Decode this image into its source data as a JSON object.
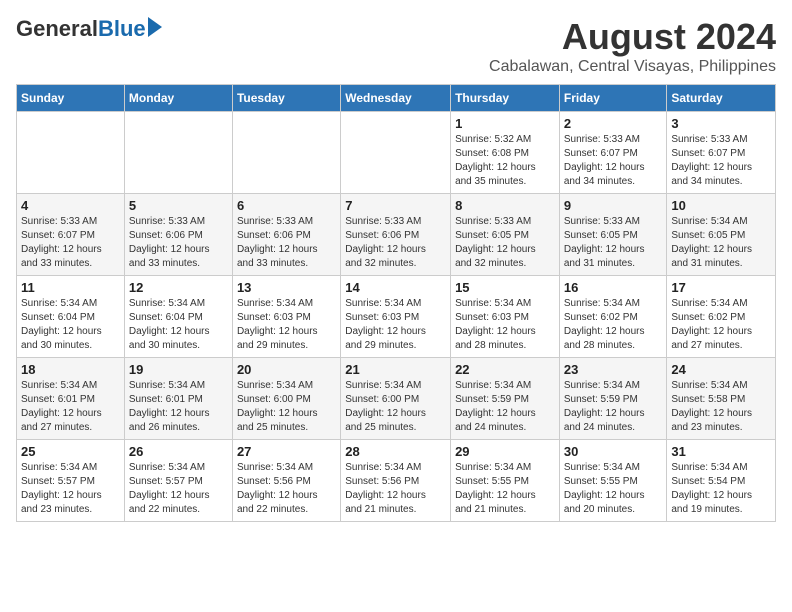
{
  "logo": {
    "general": "General",
    "blue": "Blue"
  },
  "title": "August 2024",
  "subtitle": "Cabalawan, Central Visayas, Philippines",
  "days_of_week": [
    "Sunday",
    "Monday",
    "Tuesday",
    "Wednesday",
    "Thursday",
    "Friday",
    "Saturday"
  ],
  "weeks": [
    [
      {
        "day": "",
        "info": ""
      },
      {
        "day": "",
        "info": ""
      },
      {
        "day": "",
        "info": ""
      },
      {
        "day": "",
        "info": ""
      },
      {
        "day": "1",
        "info": "Sunrise: 5:32 AM\nSunset: 6:08 PM\nDaylight: 12 hours\nand 35 minutes."
      },
      {
        "day": "2",
        "info": "Sunrise: 5:33 AM\nSunset: 6:07 PM\nDaylight: 12 hours\nand 34 minutes."
      },
      {
        "day": "3",
        "info": "Sunrise: 5:33 AM\nSunset: 6:07 PM\nDaylight: 12 hours\nand 34 minutes."
      }
    ],
    [
      {
        "day": "4",
        "info": "Sunrise: 5:33 AM\nSunset: 6:07 PM\nDaylight: 12 hours\nand 33 minutes."
      },
      {
        "day": "5",
        "info": "Sunrise: 5:33 AM\nSunset: 6:06 PM\nDaylight: 12 hours\nand 33 minutes."
      },
      {
        "day": "6",
        "info": "Sunrise: 5:33 AM\nSunset: 6:06 PM\nDaylight: 12 hours\nand 33 minutes."
      },
      {
        "day": "7",
        "info": "Sunrise: 5:33 AM\nSunset: 6:06 PM\nDaylight: 12 hours\nand 32 minutes."
      },
      {
        "day": "8",
        "info": "Sunrise: 5:33 AM\nSunset: 6:05 PM\nDaylight: 12 hours\nand 32 minutes."
      },
      {
        "day": "9",
        "info": "Sunrise: 5:33 AM\nSunset: 6:05 PM\nDaylight: 12 hours\nand 31 minutes."
      },
      {
        "day": "10",
        "info": "Sunrise: 5:34 AM\nSunset: 6:05 PM\nDaylight: 12 hours\nand 31 minutes."
      }
    ],
    [
      {
        "day": "11",
        "info": "Sunrise: 5:34 AM\nSunset: 6:04 PM\nDaylight: 12 hours\nand 30 minutes."
      },
      {
        "day": "12",
        "info": "Sunrise: 5:34 AM\nSunset: 6:04 PM\nDaylight: 12 hours\nand 30 minutes."
      },
      {
        "day": "13",
        "info": "Sunrise: 5:34 AM\nSunset: 6:03 PM\nDaylight: 12 hours\nand 29 minutes."
      },
      {
        "day": "14",
        "info": "Sunrise: 5:34 AM\nSunset: 6:03 PM\nDaylight: 12 hours\nand 29 minutes."
      },
      {
        "day": "15",
        "info": "Sunrise: 5:34 AM\nSunset: 6:03 PM\nDaylight: 12 hours\nand 28 minutes."
      },
      {
        "day": "16",
        "info": "Sunrise: 5:34 AM\nSunset: 6:02 PM\nDaylight: 12 hours\nand 28 minutes."
      },
      {
        "day": "17",
        "info": "Sunrise: 5:34 AM\nSunset: 6:02 PM\nDaylight: 12 hours\nand 27 minutes."
      }
    ],
    [
      {
        "day": "18",
        "info": "Sunrise: 5:34 AM\nSunset: 6:01 PM\nDaylight: 12 hours\nand 27 minutes."
      },
      {
        "day": "19",
        "info": "Sunrise: 5:34 AM\nSunset: 6:01 PM\nDaylight: 12 hours\nand 26 minutes."
      },
      {
        "day": "20",
        "info": "Sunrise: 5:34 AM\nSunset: 6:00 PM\nDaylight: 12 hours\nand 25 minutes."
      },
      {
        "day": "21",
        "info": "Sunrise: 5:34 AM\nSunset: 6:00 PM\nDaylight: 12 hours\nand 25 minutes."
      },
      {
        "day": "22",
        "info": "Sunrise: 5:34 AM\nSunset: 5:59 PM\nDaylight: 12 hours\nand 24 minutes."
      },
      {
        "day": "23",
        "info": "Sunrise: 5:34 AM\nSunset: 5:59 PM\nDaylight: 12 hours\nand 24 minutes."
      },
      {
        "day": "24",
        "info": "Sunrise: 5:34 AM\nSunset: 5:58 PM\nDaylight: 12 hours\nand 23 minutes."
      }
    ],
    [
      {
        "day": "25",
        "info": "Sunrise: 5:34 AM\nSunset: 5:57 PM\nDaylight: 12 hours\nand 23 minutes."
      },
      {
        "day": "26",
        "info": "Sunrise: 5:34 AM\nSunset: 5:57 PM\nDaylight: 12 hours\nand 22 minutes."
      },
      {
        "day": "27",
        "info": "Sunrise: 5:34 AM\nSunset: 5:56 PM\nDaylight: 12 hours\nand 22 minutes."
      },
      {
        "day": "28",
        "info": "Sunrise: 5:34 AM\nSunset: 5:56 PM\nDaylight: 12 hours\nand 21 minutes."
      },
      {
        "day": "29",
        "info": "Sunrise: 5:34 AM\nSunset: 5:55 PM\nDaylight: 12 hours\nand 21 minutes."
      },
      {
        "day": "30",
        "info": "Sunrise: 5:34 AM\nSunset: 5:55 PM\nDaylight: 12 hours\nand 20 minutes."
      },
      {
        "day": "31",
        "info": "Sunrise: 5:34 AM\nSunset: 5:54 PM\nDaylight: 12 hours\nand 19 minutes."
      }
    ]
  ]
}
